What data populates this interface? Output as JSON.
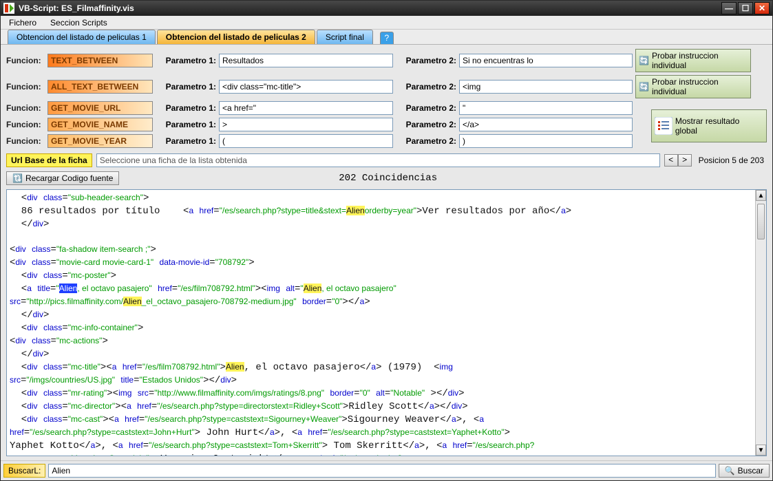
{
  "window": {
    "title": "VB-Script: ES_Filmaffinity.vis"
  },
  "menu": {
    "items": [
      "Fichero",
      "Seccion Scripts"
    ]
  },
  "tabs": {
    "left": "Obtencion del listado de peliculas 1",
    "active": "Obtencion del listado de peliculas 2",
    "right": "Script final",
    "help": "?"
  },
  "labels": {
    "funcion": "Funcion:",
    "param1": "Parametro 1:",
    "param2": "Parametro 2:"
  },
  "rows": [
    {
      "func": "TEXT_BETWEEN",
      "p1": "Resultados",
      "p2": "Si no encuentras lo"
    },
    {
      "func": "ALL_TEXT_BETWEEN",
      "p1": "<div class=\"mc-title\">",
      "p2": "<img"
    },
    {
      "func": "GET_MOVIE_URL",
      "p1": "<a href=\"",
      "p2": "\""
    },
    {
      "func": "GET_MOVIE_NAME",
      "p1": ">",
      "p2": "</a>"
    },
    {
      "func": "GET_MOVIE_YEAR",
      "p1": "(",
      "p2": ")"
    }
  ],
  "buttons": {
    "probar": "Probar instruccion individual",
    "global": "Mostrar resultado global",
    "reload": "Recargar Codigo fuente",
    "buscar": "Buscar"
  },
  "url": {
    "label": "Url Base de la ficha",
    "placeholder": "Seleccione una ficha de la lista obtenida"
  },
  "nav": {
    "pos": "Posicion 5 de 203"
  },
  "coinc": "202 Coincidencias",
  "search": {
    "label": "BuscarL:",
    "value": "Alien"
  }
}
